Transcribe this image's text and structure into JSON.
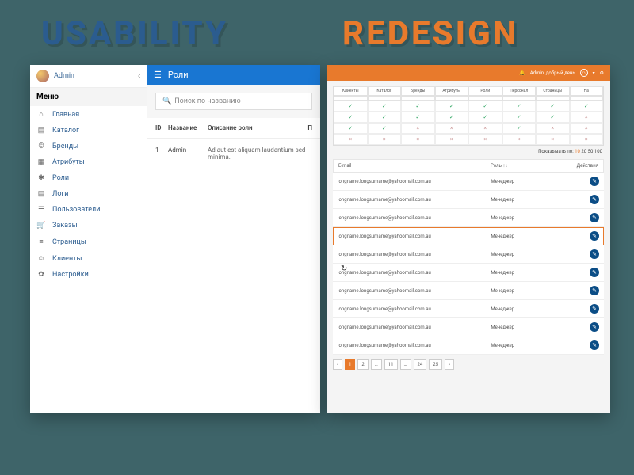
{
  "titles": {
    "left": "USABILITY",
    "right": "REDESIGN"
  },
  "left": {
    "user": "Admin",
    "menuHeading": "Меню",
    "nav": [
      {
        "icon": "⌂",
        "label": "Главная"
      },
      {
        "icon": "▤",
        "label": "Каталог"
      },
      {
        "icon": "©",
        "label": "Бренды"
      },
      {
        "icon": "▦",
        "label": "Атрибуты"
      },
      {
        "icon": "✱",
        "label": "Роли",
        "active": true
      },
      {
        "icon": "▤",
        "label": "Логи"
      },
      {
        "icon": "☰",
        "label": "Пользователи"
      },
      {
        "icon": "🛒",
        "label": "Заказы"
      },
      {
        "icon": "≡",
        "label": "Страницы"
      },
      {
        "icon": "☺",
        "label": "Клиенты"
      },
      {
        "icon": "✿",
        "label": "Настройки"
      }
    ],
    "pageTitle": "Роли",
    "searchPlaceholder": "Поиск по названию",
    "columns": {
      "id": "ID",
      "name": "Название",
      "desc": "Описание роли",
      "p": "П"
    },
    "rows": [
      {
        "id": "1",
        "name": "Admin",
        "desc": "Ad aut est aliquam laudantium sed minima."
      }
    ]
  },
  "right": {
    "greeting": "Admin, добрый день",
    "permHeaders": [
      "Клиенты",
      "Каталог",
      "Бренды",
      "Атрибуты",
      "Роли",
      "Персонал",
      "Страницы",
      "На"
    ],
    "permRows": [
      [
        "✓",
        "✓",
        "✓",
        "✓",
        "✓",
        "✓",
        "✓",
        "✓"
      ],
      [
        "✓",
        "✓",
        "✓",
        "✓",
        "✓",
        "✓",
        "✓",
        "×"
      ],
      [
        "✓",
        "✓",
        "×",
        "×",
        "×",
        "✓",
        "×",
        "×"
      ],
      [
        "×",
        "×",
        "×",
        "×",
        "×",
        "×",
        "×",
        "×"
      ]
    ],
    "pagerLabel": "Показывать по:",
    "pagerOptions": [
      "10",
      "20",
      "50",
      "100"
    ],
    "pagerCurrent": "10",
    "dataHead": {
      "email": "E-mail",
      "role": "Роль ↑↓",
      "actions": "Действия"
    },
    "rows": [
      {
        "email": "longname.longsurname@yahoomail.com.au",
        "role": "Менеджер"
      },
      {
        "email": "longname.longsurname@yahoomail.com.au",
        "role": "Менеджер"
      },
      {
        "email": "longname.longsurname@yahoomail.com.au",
        "role": "Менеджер"
      },
      {
        "email": "longname.longsurname@yahoomail.com.au",
        "role": "Менеджер",
        "selected": true
      },
      {
        "email": "longname.longsurname@yahoomail.com.au",
        "role": "Менеджер"
      },
      {
        "email": "longname.longsurname@yahoomail.com.au",
        "role": "Менеджер"
      },
      {
        "email": "longname.longsurname@yahoomail.com.au",
        "role": "Менеджер"
      },
      {
        "email": "longname.longsurname@yahoomail.com.au",
        "role": "Менеджер"
      },
      {
        "email": "longname.longsurname@yahoomail.com.au",
        "role": "Менеджер"
      },
      {
        "email": "longname.longsurname@yahoomail.com.au",
        "role": "Менеджер"
      }
    ],
    "pages": [
      "‹",
      "1",
      "2",
      "…",
      "11",
      "…",
      "24",
      "25",
      "›"
    ],
    "currentPage": "1"
  }
}
